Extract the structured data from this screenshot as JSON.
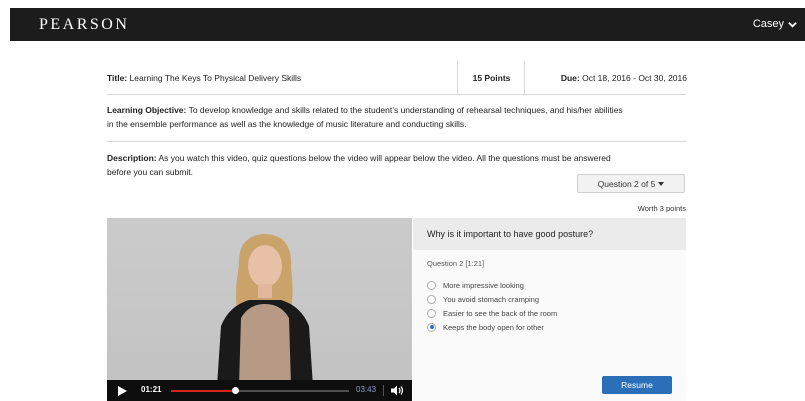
{
  "header": {
    "brand": "PEARSON",
    "user_name": "Casey"
  },
  "assignment": {
    "title_label": "Title:",
    "title_value": "Learning The Keys To Physical Delivery Skills",
    "points": "15 Points",
    "due_label": "Due:",
    "due_value": "Oct 18, 2016 - Oct 30, 2016",
    "objective_label": "Learning Objective:",
    "objective_line1": "To develop knowledge and skills related to the student’s understanding of rehearsal techniques, and his/her abilities",
    "objective_line2": "in the ensemble performance as well as the knowledge of music literature and conducting skills.",
    "description_label": "Description:",
    "description_line1": "As you watch this video, quiz questions below the video will appear below the video. All the questions must be answered",
    "description_line2": "before you can submit."
  },
  "quiz": {
    "selector_label": "Question 2 of 5",
    "worth": "Worth 3 points",
    "question": "Why is it important to have good posture?",
    "question_number": "Question 2 [1:21]",
    "options": [
      {
        "label": "More impressive looking",
        "selected": false
      },
      {
        "label": "You avoid stomach cramping",
        "selected": false
      },
      {
        "label": "Easier to see the back of the room",
        "selected": false
      },
      {
        "label": "Keeps the body open for other",
        "selected": true
      }
    ],
    "resume_label": "Resume"
  },
  "video": {
    "current_time": "01:21",
    "total_time": "03:43",
    "progress_fraction": 0.367,
    "progress_color": "#d7231a",
    "play_icon": "play-icon",
    "volume_icon": "volume-icon"
  },
  "colors": {
    "topbar": "#1c1c1c",
    "accent": "#2a6fb8"
  }
}
